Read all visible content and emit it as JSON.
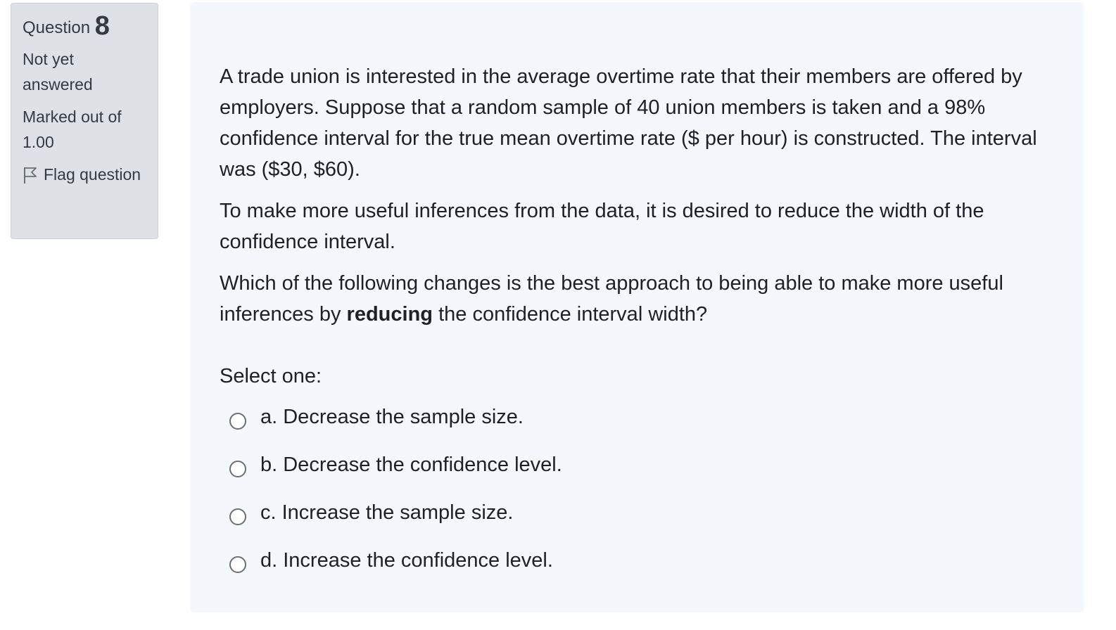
{
  "info": {
    "question_label": "Question",
    "question_number": "8",
    "state": "Not yet answered",
    "grade": "Marked out of 1.00",
    "flag_label": "Flag question",
    "flag_icon": "flag-outline-icon"
  },
  "question": {
    "para1": "A trade union is interested in the average overtime rate that their members are offered by employers. Suppose that a random sample of 40 union members is taken and a 98% confidence interval for the true mean overtime rate ($ per hour) is constructed. The interval was ($30, $60).",
    "para2": "To make more useful inferences from the data, it is desired to reduce the width of the confidence interval.",
    "para3_before": "Which of the following changes is the best approach to being able to make more useful inferences by ",
    "para3_bold": "reducing",
    "para3_after": " the confidence interval width?"
  },
  "answer_prompt": "Select one:",
  "options": [
    {
      "label": "a. Decrease the sample size."
    },
    {
      "label": "b. Decrease the confidence level."
    },
    {
      "label": "c. Increase the sample size."
    },
    {
      "label": "d. Increase the confidence level."
    }
  ],
  "colors": {
    "info_bg": "#dee2e6",
    "content_bg": "#f4f7fc",
    "text": "#1d2125"
  }
}
